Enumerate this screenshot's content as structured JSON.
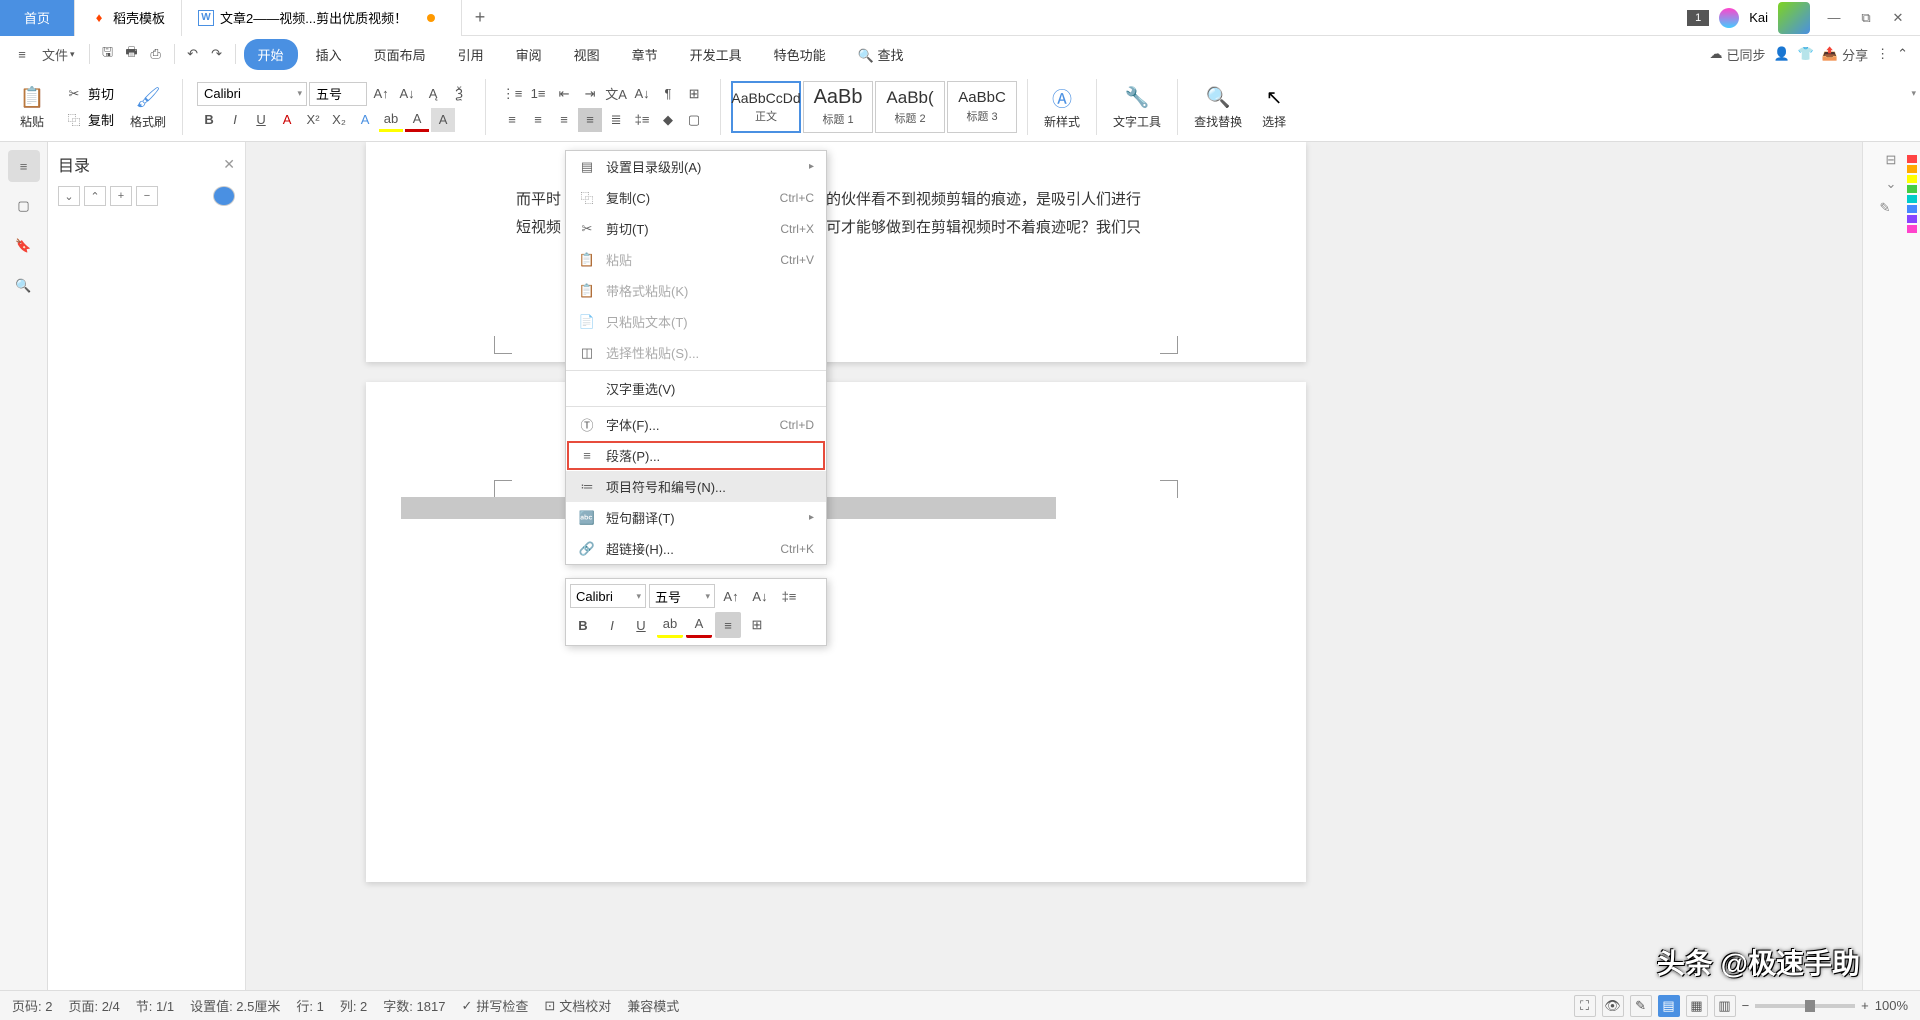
{
  "tabs": {
    "home": "首页",
    "template": "稻壳模板",
    "doc": "文章2——视频...剪出优质视频！",
    "add": "+"
  },
  "titlebar": {
    "badge": "1",
    "user": "Kai"
  },
  "win": {
    "min": "—",
    "max": "□",
    "close": "✕",
    "restore": "⧉"
  },
  "file_menu": "文件",
  "ribbon_tabs": {
    "start": "开始",
    "insert": "插入",
    "layout": "页面布局",
    "ref": "引用",
    "review": "审阅",
    "view": "视图",
    "chapter": "章节",
    "dev": "开发工具",
    "special": "特色功能",
    "find": "查找"
  },
  "menubar_right": {
    "sync": "已同步",
    "share": "分享"
  },
  "clipboard": {
    "paste": "粘贴",
    "cut": "剪切",
    "copy": "复制",
    "painter": "格式刷"
  },
  "font": {
    "name": "Calibri",
    "size": "五号"
  },
  "styles": {
    "s1": {
      "preview": "AaBbCcDd",
      "name": "正文"
    },
    "s2": {
      "preview": "AaBb",
      "name": "标题 1"
    },
    "s3": {
      "preview": "AaBb(",
      "name": "标题 2"
    },
    "s4": {
      "preview": "AaBbC",
      "name": "标题 3"
    },
    "new": "新样式",
    "texttool": "文字工具",
    "findreplace": "查找替换",
    "select": "选择"
  },
  "nav": {
    "title": "目录"
  },
  "doc": {
    "line1": "而平时",
    "line2": "短视频",
    "line1b": "的伙伴看不到视频剪辑的痕迹，是吸引人们进行",
    "line2b": "可才能够做到在剪辑视频时不着痕迹呢？我们只"
  },
  "context": [
    {
      "ico": "▤",
      "label": "设置目录级别(A)",
      "arrow": true
    },
    {
      "ico": "⿻",
      "label": "复制(C)",
      "sc": "Ctrl+C"
    },
    {
      "ico": "✂",
      "label": "剪切(T)",
      "sc": "Ctrl+X"
    },
    {
      "ico": "📋",
      "label": "粘贴",
      "sc": "Ctrl+V",
      "dis": true
    },
    {
      "ico": "📋",
      "label": "带格式粘贴(K)",
      "dis": true
    },
    {
      "ico": "📄",
      "label": "只粘贴文本(T)",
      "dis": true
    },
    {
      "ico": "◫",
      "label": "选择性粘贴(S)...",
      "dis": true
    },
    {
      "sep": true
    },
    {
      "label": "汉字重选(V)"
    },
    {
      "sep": true
    },
    {
      "ico": "Ⓣ",
      "label": "字体(F)...",
      "sc": "Ctrl+D"
    },
    {
      "ico": "≡",
      "label": "段落(P)...",
      "hl": true
    },
    {
      "ico": "≔",
      "label": "项目符号和编号(N)...",
      "hover": true
    },
    {
      "ico": "🔤",
      "label": "短句翻译(T)",
      "arrow": true
    },
    {
      "ico": "🔗",
      "label": "超链接(H)...",
      "sc": "Ctrl+K"
    }
  ],
  "mini": {
    "font": "Calibri",
    "size": "五号"
  },
  "status": {
    "pagenum": "页码: 2",
    "page": "页面: 2/4",
    "section": "节: 1/1",
    "setval": "设置值: 2.5厘米",
    "row": "行: 1",
    "col": "列: 2",
    "chars": "字数: 1817",
    "spell": "拼写检查",
    "proof": "文档校对",
    "compat": "兼容模式",
    "zoom": "100%"
  },
  "watermark": "头条 @极速手助"
}
